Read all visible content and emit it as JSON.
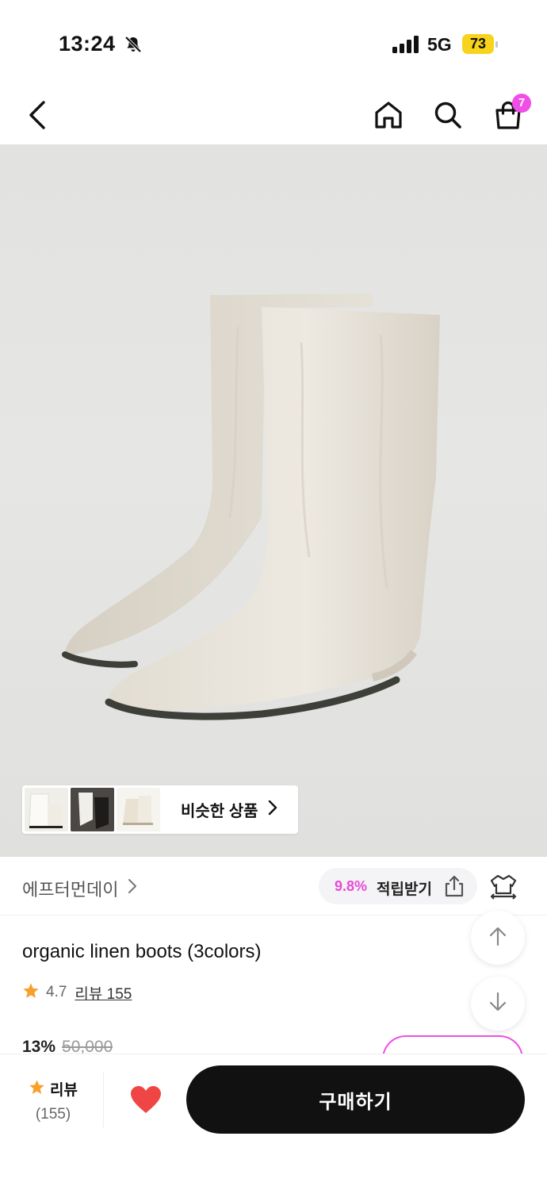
{
  "status_bar": {
    "time": "13:24",
    "network": "5G",
    "battery": "73",
    "icons": [
      "bell-slash-icon",
      "signal-bars-icon"
    ]
  },
  "nav": {
    "icons": [
      "back-arrow-icon",
      "home-icon",
      "search-icon",
      "shopping-bag-icon"
    ],
    "cart_count": "7",
    "accent_color": "#f04ee6"
  },
  "gallery": {
    "product_image_description": "beige linen boots",
    "similar_products_label": "비슷한 상품"
  },
  "brand": {
    "name": "에프터먼데이",
    "reward_rate": "9.8%",
    "reward_label": "적립받기",
    "icons": [
      "share-icon",
      "hanger-icon"
    ]
  },
  "product": {
    "title": "organic linen boots (3colors)",
    "rating": "4.7",
    "review_link": "리뷰 155",
    "discount_rate": "13%",
    "original_price": "50,000"
  },
  "bottom_bar": {
    "review_label": "리뷰",
    "review_count": "(155)",
    "buy_label": "구매하기",
    "like_color": "#f04545"
  }
}
